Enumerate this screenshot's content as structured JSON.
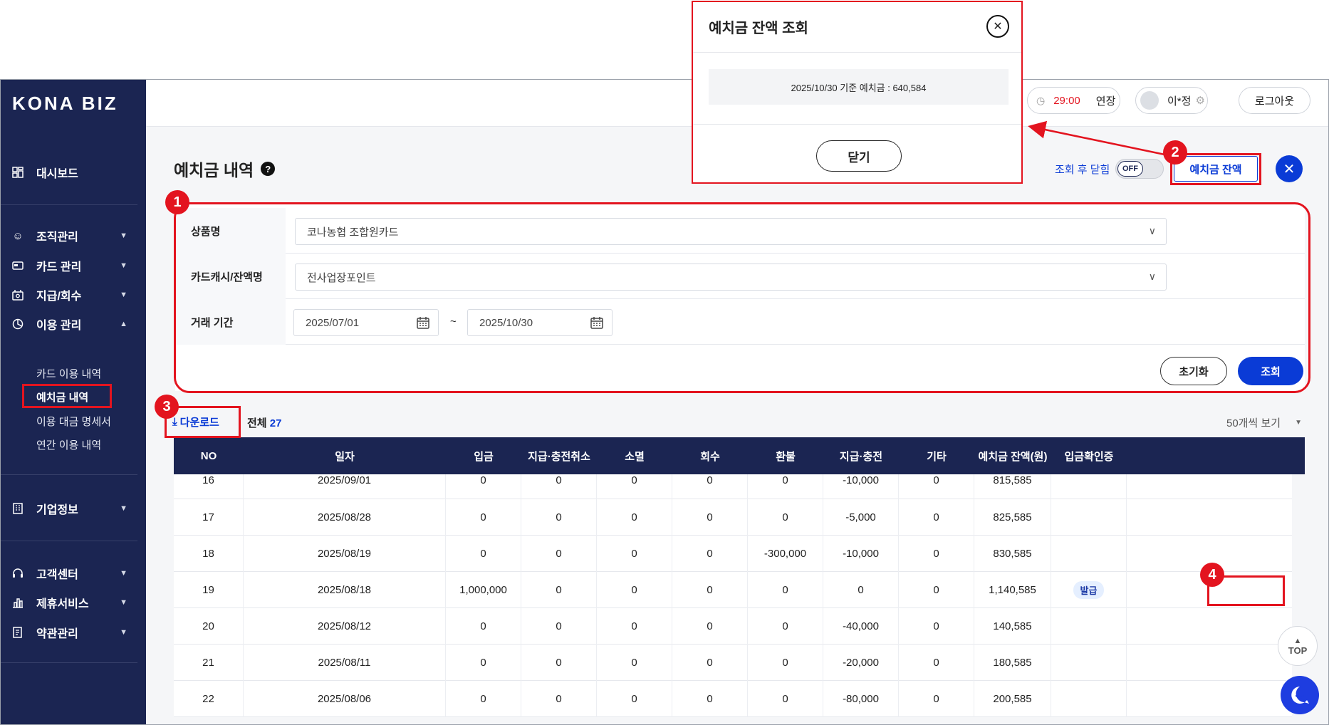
{
  "brand": "KONA BIZ",
  "sidebar": {
    "items": [
      {
        "label": "대시보드",
        "icon": "dashboard-icon"
      },
      {
        "label": "조직관리",
        "icon": "organization-icon"
      },
      {
        "label": "카드 관리",
        "icon": "card-icon"
      },
      {
        "label": "지급/회수",
        "icon": "payment-icon"
      },
      {
        "label": "이용 관리",
        "icon": "usage-icon"
      },
      {
        "label": "기업정보",
        "icon": "company-icon"
      },
      {
        "label": "고객센터",
        "icon": "headset-icon"
      },
      {
        "label": "제휴서비스",
        "icon": "partner-icon"
      },
      {
        "label": "약관관리",
        "icon": "terms-icon"
      }
    ],
    "subitems": [
      "카드 이용 내역",
      "예치금 내역",
      "이용 대금 명세서",
      "연간 이용 내역"
    ]
  },
  "header": {
    "timer": "29:00",
    "extend": "연장",
    "user": "이*정",
    "logout": "로그아웃"
  },
  "page": {
    "title": "예치금 내역",
    "toggle_label": "조회 후 닫힘",
    "toggle_state": "OFF",
    "balance_button": "예치금 잔액"
  },
  "filter": {
    "product_label": "상품명",
    "product_value": "코나농협 조합원카드",
    "cash_label": "카드캐시/잔액명",
    "cash_value": "전사업장포인트",
    "period_label": "거래 기간",
    "date_from": "2025/07/01",
    "date_sep": "~",
    "date_to": "2025/10/30",
    "reset": "초기화",
    "search": "조회"
  },
  "toolbar": {
    "download": "다운로드",
    "total_label": "전체",
    "total_count": "27",
    "page_size": "50개씩 보기"
  },
  "table": {
    "columns": [
      "NO",
      "일자",
      "입금",
      "지급·충전취소",
      "소멸",
      "회수",
      "환불",
      "지급·충전",
      "기타",
      "예치금 잔액(원)",
      "입금확인증"
    ],
    "rows": [
      [
        "16",
        "2025/09/01",
        "0",
        "0",
        "0",
        "0",
        "0",
        "-10,000",
        "0",
        "815,585",
        ""
      ],
      [
        "17",
        "2025/08/28",
        "0",
        "0",
        "0",
        "0",
        "0",
        "-5,000",
        "0",
        "825,585",
        ""
      ],
      [
        "18",
        "2025/08/19",
        "0",
        "0",
        "0",
        "0",
        "-300,000",
        "-10,000",
        "0",
        "830,585",
        ""
      ],
      [
        "19",
        "2025/08/18",
        "1,000,000",
        "0",
        "0",
        "0",
        "0",
        "0",
        "0",
        "1,140,585",
        "발급"
      ],
      [
        "20",
        "2025/08/12",
        "0",
        "0",
        "0",
        "0",
        "0",
        "-40,000",
        "0",
        "140,585",
        ""
      ],
      [
        "21",
        "2025/08/11",
        "0",
        "0",
        "0",
        "0",
        "0",
        "-20,000",
        "0",
        "180,585",
        ""
      ],
      [
        "22",
        "2025/08/06",
        "0",
        "0",
        "0",
        "0",
        "0",
        "-80,000",
        "0",
        "200,585",
        ""
      ]
    ]
  },
  "modal": {
    "title": "예치금 잔액 조회",
    "message": "2025/10/30 기준 예치금 : 640,584",
    "close": "닫기"
  },
  "misc": {
    "top": "TOP"
  },
  "markers": [
    "1",
    "2",
    "3",
    "4"
  ],
  "colors": {
    "navy": "#1b2552",
    "accent": "#0a3bd6",
    "annotation": "#e3141f",
    "timer": "#e3141f"
  }
}
